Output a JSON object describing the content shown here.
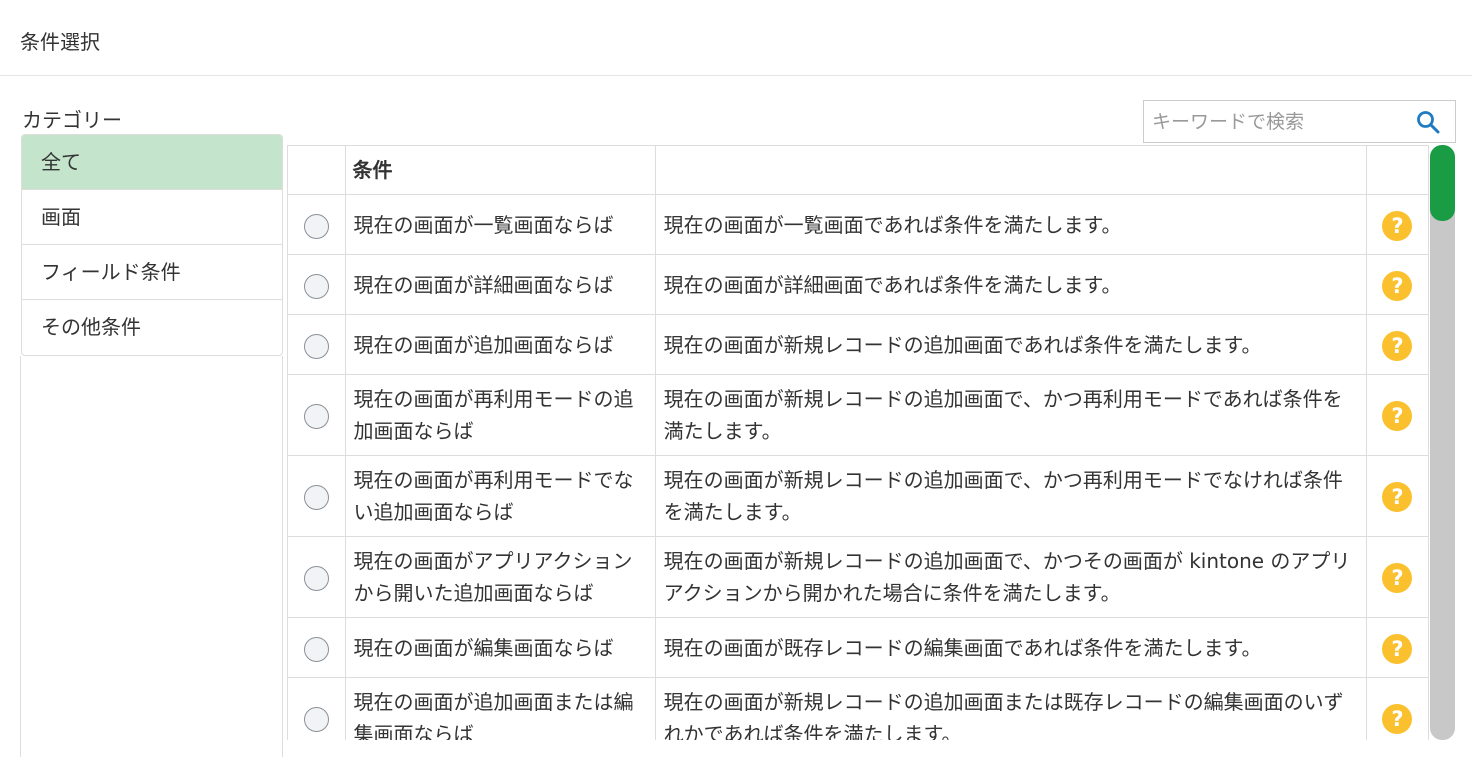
{
  "header": {
    "title": "条件選択"
  },
  "categories": {
    "label": "カテゴリー",
    "items": [
      {
        "label": "全て"
      },
      {
        "label": "画面"
      },
      {
        "label": "フィールド条件"
      },
      {
        "label": "その他条件"
      }
    ]
  },
  "search": {
    "placeholder": "キーワードで検索"
  },
  "table": {
    "headers": {
      "condition": "条件",
      "description": ""
    },
    "rows": [
      {
        "name": "現在の画面が一覧画面ならば",
        "desc": "現在の画面が一覧画面であれば条件を満たします。"
      },
      {
        "name": "現在の画面が詳細画面ならば",
        "desc": "現在の画面が詳細画面であれば条件を満たします。"
      },
      {
        "name": "現在の画面が追加画面ならば",
        "desc": "現在の画面が新規レコードの追加画面であれば条件を満たします。"
      },
      {
        "name": "現在の画面が再利用モードの追加画面ならば",
        "desc": "現在の画面が新規レコードの追加画面で、かつ再利用モードであれば条件を満たします。"
      },
      {
        "name": "現在の画面が再利用モードでない追加画面ならば",
        "desc": "現在の画面が新規レコードの追加画面で、かつ再利用モードでなければ条件を満たします。"
      },
      {
        "name": "現在の画面がアプリアクションから開いた追加画面ならば",
        "desc": "現在の画面が新規レコードの追加画面で、かつその画面が kintone のアプリアクションから開かれた場合に条件を満たします。"
      },
      {
        "name": "現在の画面が編集画面ならば",
        "desc": "現在の画面が既存レコードの編集画面であれば条件を満たします。"
      },
      {
        "name": "現在の画面が追加画面または編集画面ならば",
        "desc": "現在の画面が新規レコードの追加画面または既存レコードの編集画面のいずれかであれば条件を満たします。"
      }
    ],
    "help_glyph": "?"
  },
  "colors": {
    "active_category": "#c4e5cc",
    "help_icon": "#fbc02d",
    "scroll_thumb": "#1a9c45",
    "search_icon": "#1f7bc1"
  }
}
